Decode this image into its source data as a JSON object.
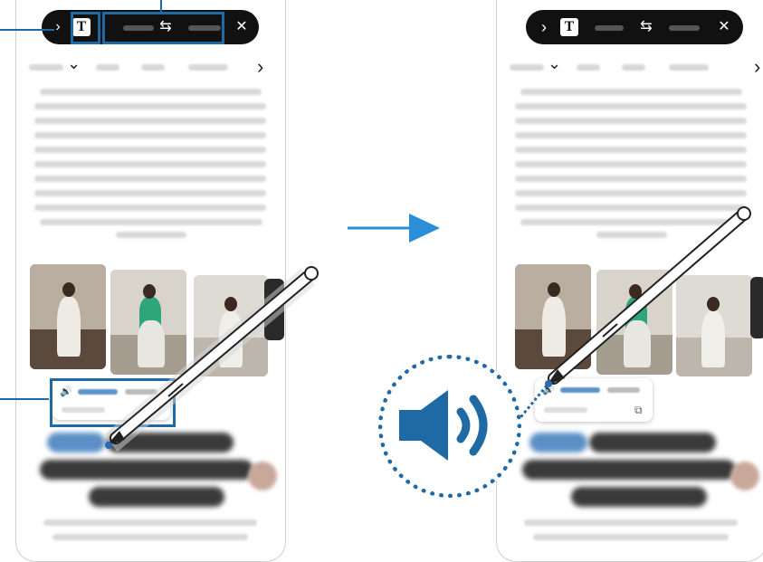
{
  "left_panel": {
    "toolbar": {
      "back_icon": "chevron-right-icon",
      "text_mode_label": "T",
      "swap_icon": "⇆",
      "close_icon": "✕"
    },
    "nav_chevron": "⌄",
    "nav_next": "›"
  },
  "right_panel": {
    "toolbar": {
      "back_icon": "›",
      "text_mode_label": "T",
      "swap_icon": "⇆",
      "close_icon": "✕"
    },
    "nav_chevron": "⌄",
    "nav_next": "›"
  },
  "transition": {
    "arrow_icon": "arrow-right-icon"
  },
  "tooltip": {
    "speaker_icon": "🔊",
    "copy_icon": "⧉"
  },
  "colors": {
    "accent": "#1f6aa5",
    "toolbar_bg": "#111111",
    "arrow": "#2a8fd6"
  }
}
